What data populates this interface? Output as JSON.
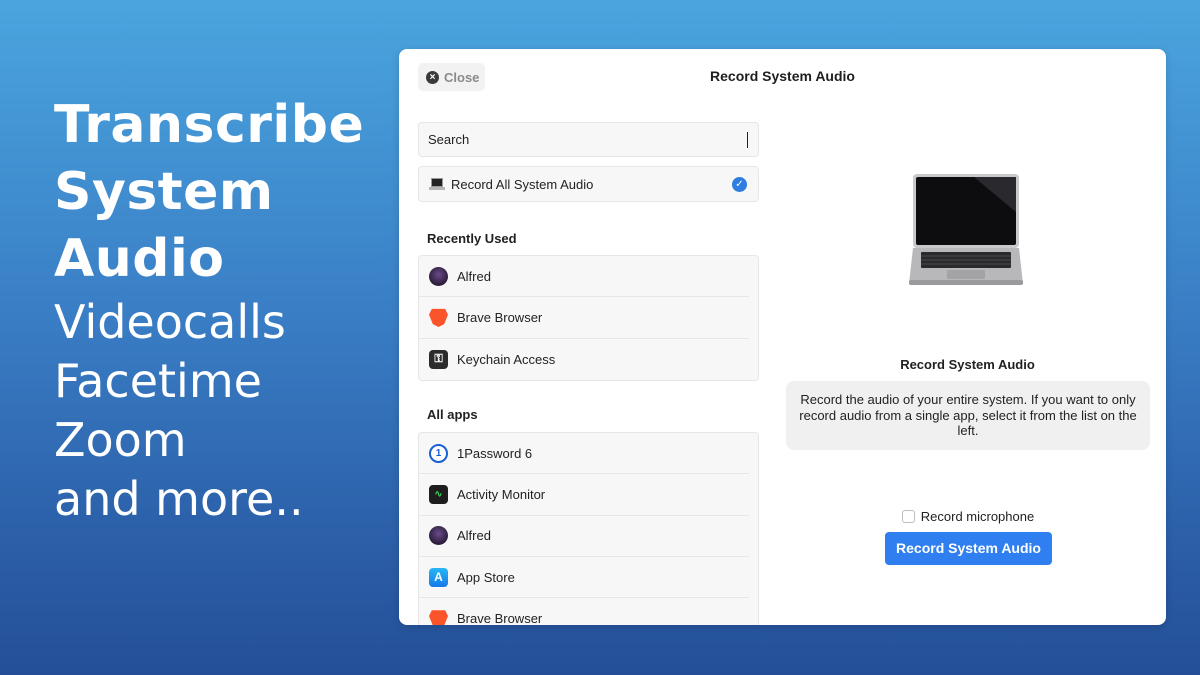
{
  "promo": {
    "line1": "Transcribe",
    "line2": "System",
    "line3": "Audio",
    "line4": "Videocalls",
    "line5": "Facetime",
    "line6": "Zoom",
    "line7": "and more.."
  },
  "window": {
    "close_label": "Close",
    "title": "Record System Audio"
  },
  "search": {
    "placeholder": "Search"
  },
  "all_audio": {
    "label": "Record All System Audio",
    "selected": true
  },
  "recently_used": {
    "heading": "Recently Used",
    "items": [
      {
        "label": "Alfred",
        "icon": "alfred-icon"
      },
      {
        "label": "Brave Browser",
        "icon": "brave-icon"
      },
      {
        "label": "Keychain Access",
        "icon": "keychain-icon"
      }
    ]
  },
  "all_apps": {
    "heading": "All apps",
    "items": [
      {
        "label": "1Password 6",
        "icon": "1password-icon"
      },
      {
        "label": "Activity Monitor",
        "icon": "activity-monitor-icon"
      },
      {
        "label": "Alfred",
        "icon": "alfred-icon"
      },
      {
        "label": "App Store",
        "icon": "app-store-icon"
      },
      {
        "label": "Brave Browser",
        "icon": "brave-icon"
      }
    ]
  },
  "detail": {
    "title": "Record System Audio",
    "description": "Record the audio of your entire system. If you want to only record audio from a single app, select it from the list on the left.",
    "mic_label": "Record microphone",
    "mic_checked": false,
    "record_button": "Record System Audio"
  },
  "colors": {
    "accent": "#2f7ff0",
    "background_top": "#4aa5de",
    "background_bottom": "#244f98"
  }
}
